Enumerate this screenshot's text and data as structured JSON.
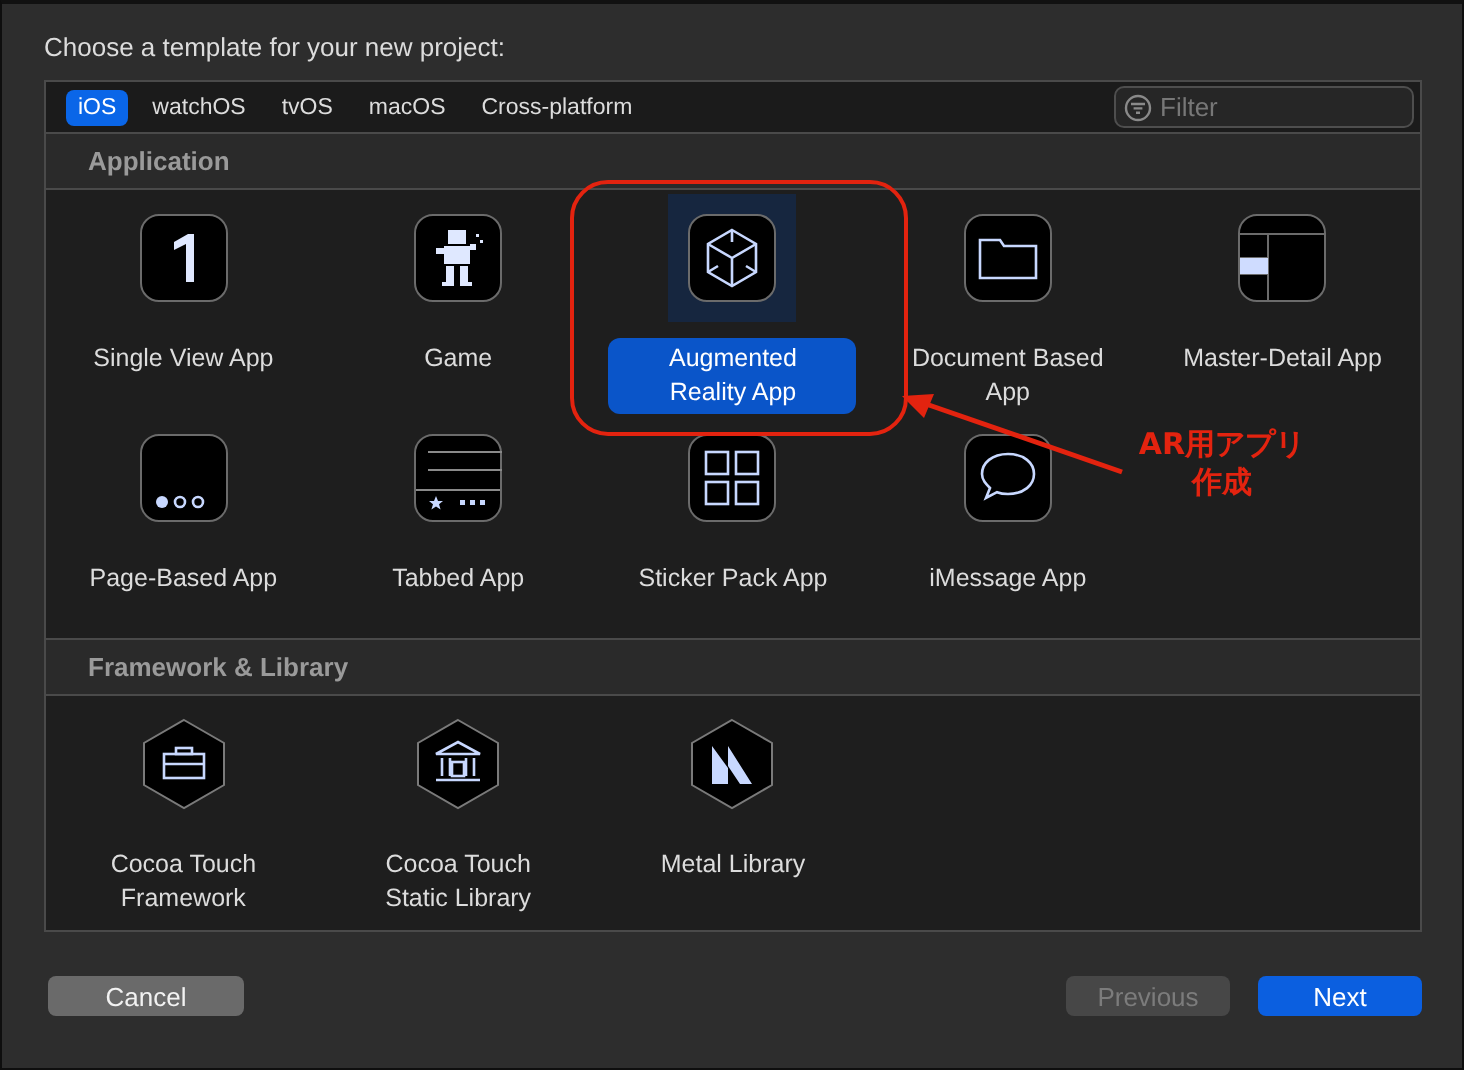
{
  "dialog": {
    "title": "Choose a template for your new project:"
  },
  "tabs": [
    {
      "label": "iOS",
      "selected": true
    },
    {
      "label": "watchOS",
      "selected": false
    },
    {
      "label": "tvOS",
      "selected": false
    },
    {
      "label": "macOS",
      "selected": false
    },
    {
      "label": "Cross-platform",
      "selected": false
    }
  ],
  "filter": {
    "placeholder": "Filter"
  },
  "sections": [
    {
      "title": "Application",
      "items": [
        {
          "label": "Single View App",
          "selected": false
        },
        {
          "label": "Game",
          "selected": false
        },
        {
          "label": "Augmented Reality App",
          "selected": true
        },
        {
          "label": "Document Based App",
          "selected": false
        },
        {
          "label": "Master-Detail App",
          "selected": false
        },
        {
          "label": "Page-Based App",
          "selected": false
        },
        {
          "label": "Tabbed App",
          "selected": false
        },
        {
          "label": "Sticker Pack App",
          "selected": false
        },
        {
          "label": "iMessage App",
          "selected": false
        }
      ]
    },
    {
      "title": "Framework & Library",
      "items": [
        {
          "label": "Cocoa Touch Framework",
          "selected": false
        },
        {
          "label": "Cocoa Touch Static Library",
          "selected": false
        },
        {
          "label": "Metal Library",
          "selected": false
        }
      ]
    }
  ],
  "annotation": {
    "lines": [
      "AR用アプリ",
      "作成"
    ]
  },
  "buttons": [
    {
      "label": "Cancel",
      "kind": "normal",
      "disabled": false
    },
    {
      "label": "Previous",
      "kind": "normal",
      "disabled": true
    },
    {
      "label": "Next",
      "kind": "primary",
      "disabled": false
    }
  ]
}
